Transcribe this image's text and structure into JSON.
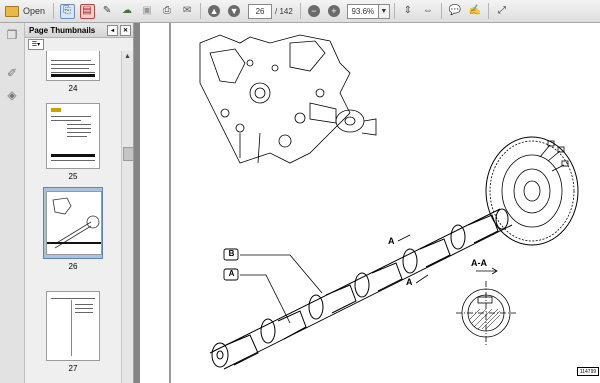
{
  "toolbar": {
    "open_label": "Open",
    "page_current": "26",
    "page_total": "/ 142",
    "zoom_value": "93.6%"
  },
  "thumbnails_panel": {
    "title": "Page Thumbnails",
    "thumbnails": [
      {
        "label": "24"
      },
      {
        "label": "25"
      },
      {
        "label": "26"
      },
      {
        "label": "27"
      }
    ]
  },
  "document": {
    "callout_b": "B",
    "callout_a": "A",
    "section_label": "A-A",
    "arrow_a_upper": "A",
    "arrow_a_lower": "A",
    "page_id": "114799"
  }
}
